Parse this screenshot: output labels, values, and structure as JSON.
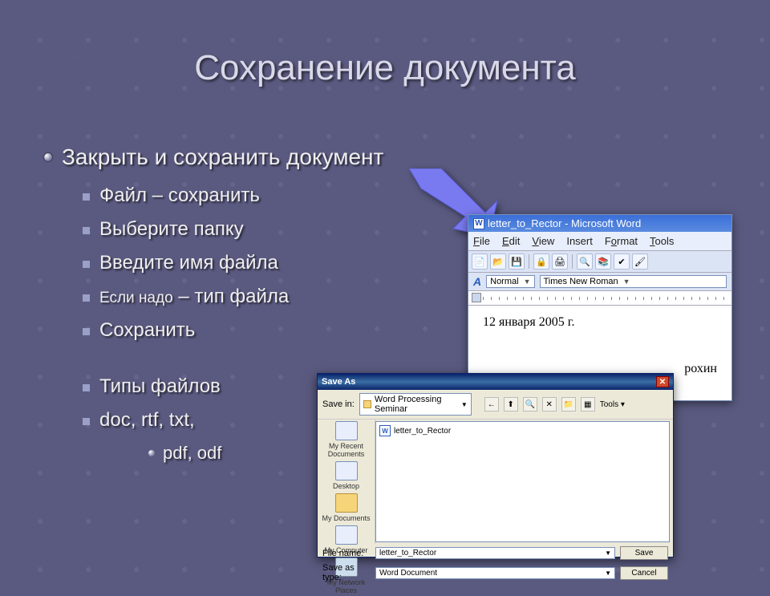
{
  "slide": {
    "title": "Сохранение документа",
    "bullet1": "Закрыть и сохранить документ",
    "sub": [
      "Файл – сохранить",
      "Выберите папку",
      "Введите имя файла",
      "Сохранить",
      "Типы файлов",
      "doc, rtf, txt,"
    ],
    "sub_mixed_prefix": "Если надо",
    "sub_mixed_suffix": " – тип файла",
    "sub3": "pdf, odf"
  },
  "word": {
    "title": "letter_to_Rector - Microsoft Word",
    "menus": {
      "file": "File",
      "edit": "Edit",
      "view": "View",
      "insert": "Insert",
      "format": "Format",
      "tools": "Tools"
    },
    "style_label": "Normal",
    "font_label": "Times New Roman",
    "doc_line1": "12 января 2005 г.",
    "doc_line2": "рохин"
  },
  "dialog": {
    "title": "Save As",
    "savein_label": "Save in:",
    "savein_value": "Word Processing Seminar",
    "tools_label": "Tools",
    "places": {
      "recent": "My Recent Documents",
      "desktop": "Desktop",
      "mydocs": "My Documents",
      "mycomp": "My Computer",
      "network": "My Network Places"
    },
    "file_in_list": "letter_to_Rector",
    "filename_label": "File name:",
    "filename_value": "letter_to_Rector",
    "savetype_label": "Save as type:",
    "savetype_value": "Word Document",
    "save_btn": "Save",
    "cancel_btn": "Cancel"
  }
}
